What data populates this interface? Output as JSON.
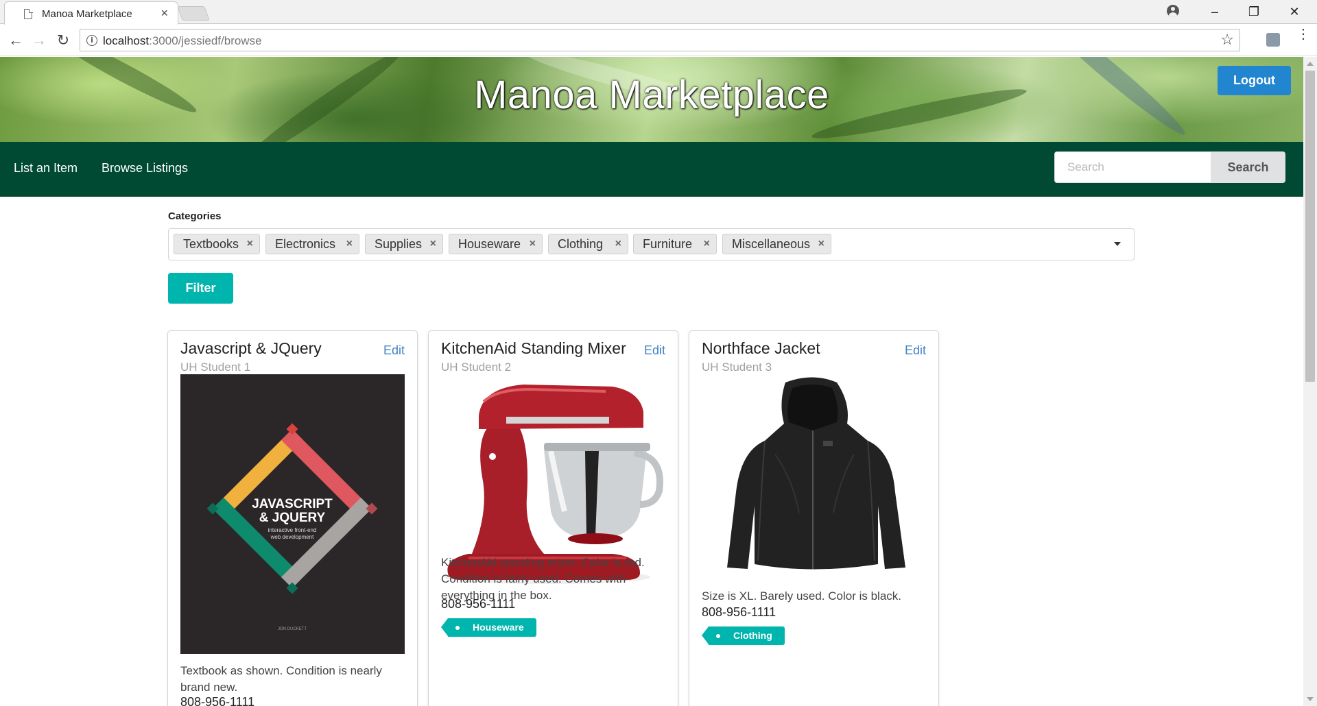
{
  "browser": {
    "tab_title": "Manoa Marketplace",
    "tab_close": "×",
    "url_host": "localhost",
    "url_path": ":3000/jessiedf/browse",
    "minimize": "–",
    "restore": "❐",
    "close": "✕",
    "back": "←",
    "forward": "→",
    "reload": "↻",
    "info": "i",
    "star": "☆",
    "menu": "⋮"
  },
  "header": {
    "title": "Manoa Marketplace",
    "logout_label": "Logout"
  },
  "nav": {
    "items": [
      {
        "label": "List an Item"
      },
      {
        "label": "Browse Listings"
      }
    ],
    "search_placeholder": "Search",
    "search_label": "Search"
  },
  "filter": {
    "label": "Categories",
    "selected": [
      "Textbooks",
      "Electronics",
      "Supplies",
      "Houseware",
      "Clothing",
      "Furniture",
      "Miscellaneous"
    ],
    "remove_glyph": "×",
    "button_label": "Filter"
  },
  "listings": [
    {
      "title": "Javascript & JQuery",
      "seller": "UH Student 1",
      "edit_label": "Edit",
      "description": "Textbook as shown. Condition is nearly brand new.",
      "phone": "808-956-1111",
      "image": {
        "title_line1": "JAVASCRIPT",
        "title_line2": "& JQUERY",
        "subtitle_line1": "interactive front-end",
        "subtitle_line2": "web development",
        "author": "JON DUCKETT"
      }
    },
    {
      "title": "KitchenAid Standing Mixer",
      "seller": "UH Student 2",
      "edit_label": "Edit",
      "description": "KitchenAid standing mixer. Color is red. Condition is fairly used. Comes with everything in the box.",
      "phone": "808-956-1111",
      "tag": "Houseware"
    },
    {
      "title": "Northface Jacket",
      "seller": "UH Student 3",
      "edit_label": "Edit",
      "description": "Size is XL. Barely used. Color is black.",
      "phone": "808-956-1111",
      "tag": "Clothing"
    }
  ],
  "colors": {
    "menubar": "#004a33",
    "logout": "#2185d0",
    "filter_button": "#00b5ad",
    "tag": "#00b5ad",
    "edit_link": "#4183c4"
  }
}
